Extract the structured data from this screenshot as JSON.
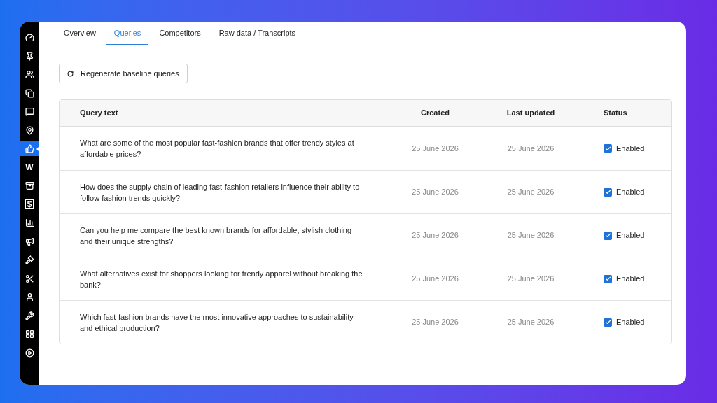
{
  "sidebar": {
    "items": [
      {
        "selected": false
      },
      {
        "selected": false
      },
      {
        "selected": false
      },
      {
        "selected": false
      },
      {
        "selected": false
      },
      {
        "selected": false
      },
      {
        "selected": true
      },
      {
        "selected": false,
        "label": "W"
      },
      {
        "selected": false
      },
      {
        "selected": false,
        "label": "$"
      },
      {
        "selected": false
      },
      {
        "selected": false
      },
      {
        "selected": false
      },
      {
        "selected": false
      },
      {
        "selected": false
      },
      {
        "selected": false
      },
      {
        "selected": false
      },
      {
        "selected": false
      }
    ]
  },
  "tabs": [
    {
      "label": "Overview",
      "selected": false
    },
    {
      "label": "Queries",
      "selected": true
    },
    {
      "label": "Competitors",
      "selected": false
    },
    {
      "label": "Raw data / Transcripts",
      "selected": false
    }
  ],
  "regenerate_button": {
    "label": "Regenerate baseline queries"
  },
  "table": {
    "columns": [
      "Query text",
      "Created",
      "Last updated",
      "Status"
    ],
    "rows": [
      {
        "query": "What are some of the most popular fast-fashion brands that offer trendy styles at affordable prices?",
        "created": "25 June 2026",
        "updated": "25 June 2026",
        "status": "Enabled",
        "checked": true
      },
      {
        "query": "How does the supply chain of leading fast-fashion retailers influence their ability to follow fashion trends quickly?",
        "created": "25 June 2026",
        "updated": "25 June 2026",
        "status": "Enabled",
        "checked": true
      },
      {
        "query": "Can you help me compare the best known brands for affordable, stylish clothing and their unique strengths?",
        "created": "25 June 2026",
        "updated": "25 June 2026",
        "status": "Enabled",
        "checked": true
      },
      {
        "query": "What alternatives exist for shoppers looking for trendy apparel without breaking the bank?",
        "created": "25 June 2026",
        "updated": "25 June 2026",
        "status": "Enabled",
        "checked": true
      },
      {
        "query": "Which fast-fashion brands have the most innovative approaches to sustainability and ethical production?",
        "created": "25 June 2026",
        "updated": "25 June 2026",
        "status": "Enabled",
        "checked": true
      }
    ]
  }
}
